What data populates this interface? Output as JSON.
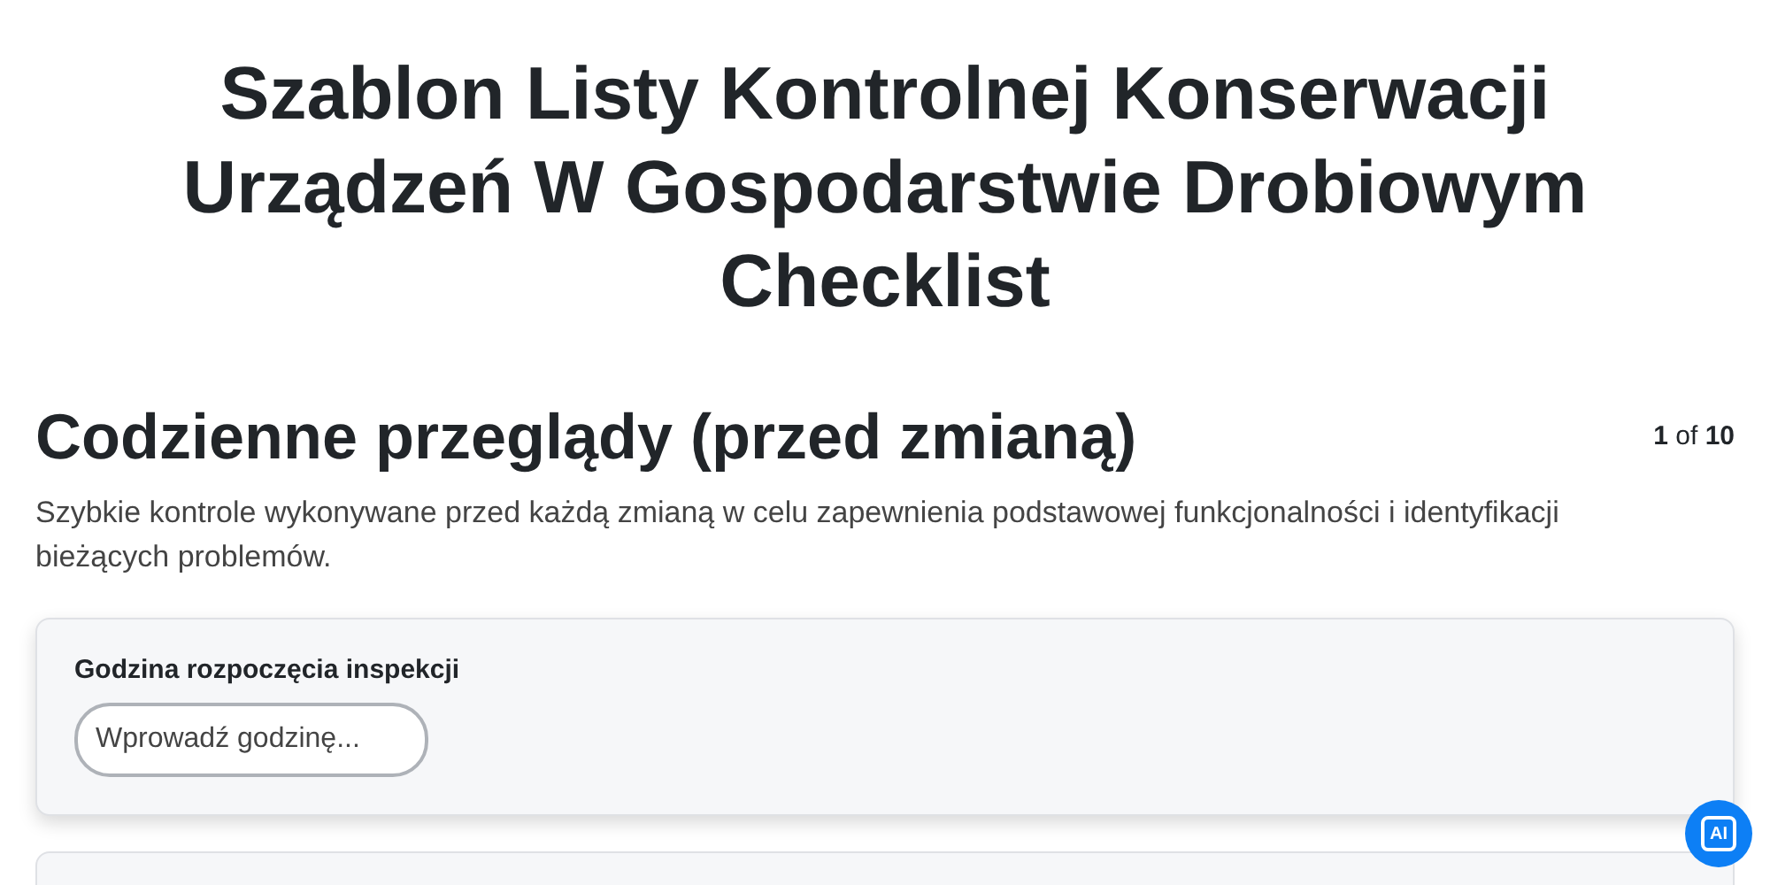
{
  "title": "Szablon Listy Kontrolnej Konserwacji Urządzeń W Gospodarstwie Drobiowym Checklist",
  "section": {
    "heading": "Codzienne przeglądy (przed zmianą)",
    "page_current": "1",
    "page_of": "of",
    "page_total": "10",
    "description": "Szybkie kontrole wykonywane przed każdą zmianą w celu zapewnienia podstawowej funkcjonalności i identyfikacji bieżących problemów."
  },
  "fields": [
    {
      "label": "Godzina rozpoczęcia inspekcji",
      "placeholder": "Wprowadź godzinę..."
    }
  ],
  "ai_badge": {
    "label": "AI"
  }
}
